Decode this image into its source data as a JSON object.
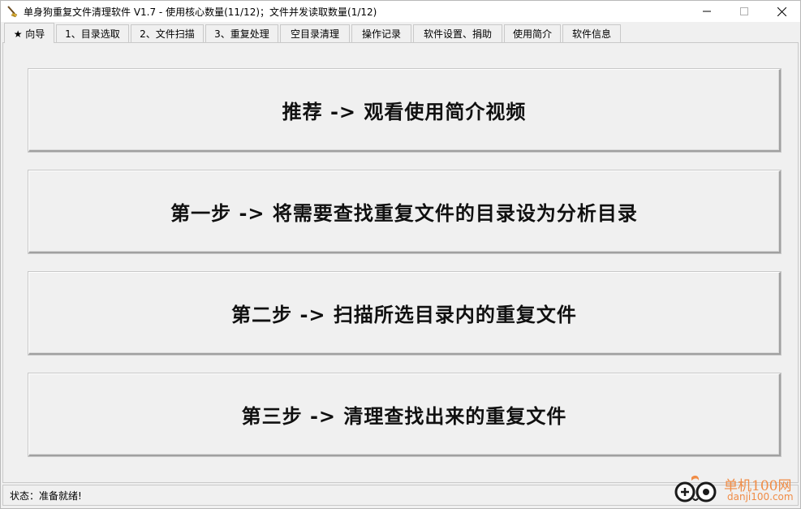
{
  "window": {
    "title": "单身狗重复文件清理软件 V1.7  -  使用核心数量(11/12)；文件并发读取数量(1/12)"
  },
  "tabs": [
    {
      "label": "★ 向导",
      "active": true
    },
    {
      "label": "1、目录选取",
      "active": false
    },
    {
      "label": "2、文件扫描",
      "active": false
    },
    {
      "label": "3、重复处理",
      "active": false
    },
    {
      "label": "空目录清理",
      "active": false
    },
    {
      "label": "操作记录",
      "active": false
    },
    {
      "label": "软件设置、捐助",
      "active": false
    },
    {
      "label": "使用简介",
      "active": false
    },
    {
      "label": "软件信息",
      "active": false
    }
  ],
  "main": {
    "buttons": [
      {
        "label": "推荐 -> 观看使用简介视频"
      },
      {
        "label": "第一步 -> 将需要查找重复文件的目录设为分析目录"
      },
      {
        "label": "第二步 -> 扫描所选目录内的重复文件"
      },
      {
        "label": "第三步 -> 清理查找出来的重复文件"
      }
    ]
  },
  "status": {
    "text": "状态：准备就绪!"
  },
  "watermark": {
    "cn": "单机100网",
    "en": "danji100.com",
    "color": "#f08c46"
  },
  "icons": {
    "app": "broom-icon",
    "minimize": "minimize-icon",
    "maximize": "maximize-icon",
    "close": "close-icon"
  }
}
